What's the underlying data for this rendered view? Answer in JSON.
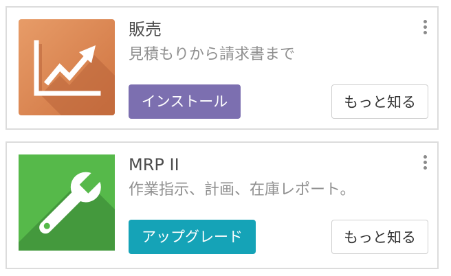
{
  "apps": [
    {
      "name": "販売",
      "summary": "見積もりから請求書まで",
      "primary_label": "インストール",
      "secondary_label": "もっと知る",
      "icon": "sales-chart-icon",
      "tile_color": "#d6804f",
      "button_color": "#7c6fb0"
    },
    {
      "name": "MRP II",
      "summary": "作業指示、計画、在庫レポート。",
      "primary_label": "アップグレード",
      "secondary_label": "もっと知る",
      "icon": "wrench-icon",
      "tile_color": "#56b94a",
      "button_color": "#15a3b7"
    }
  ]
}
